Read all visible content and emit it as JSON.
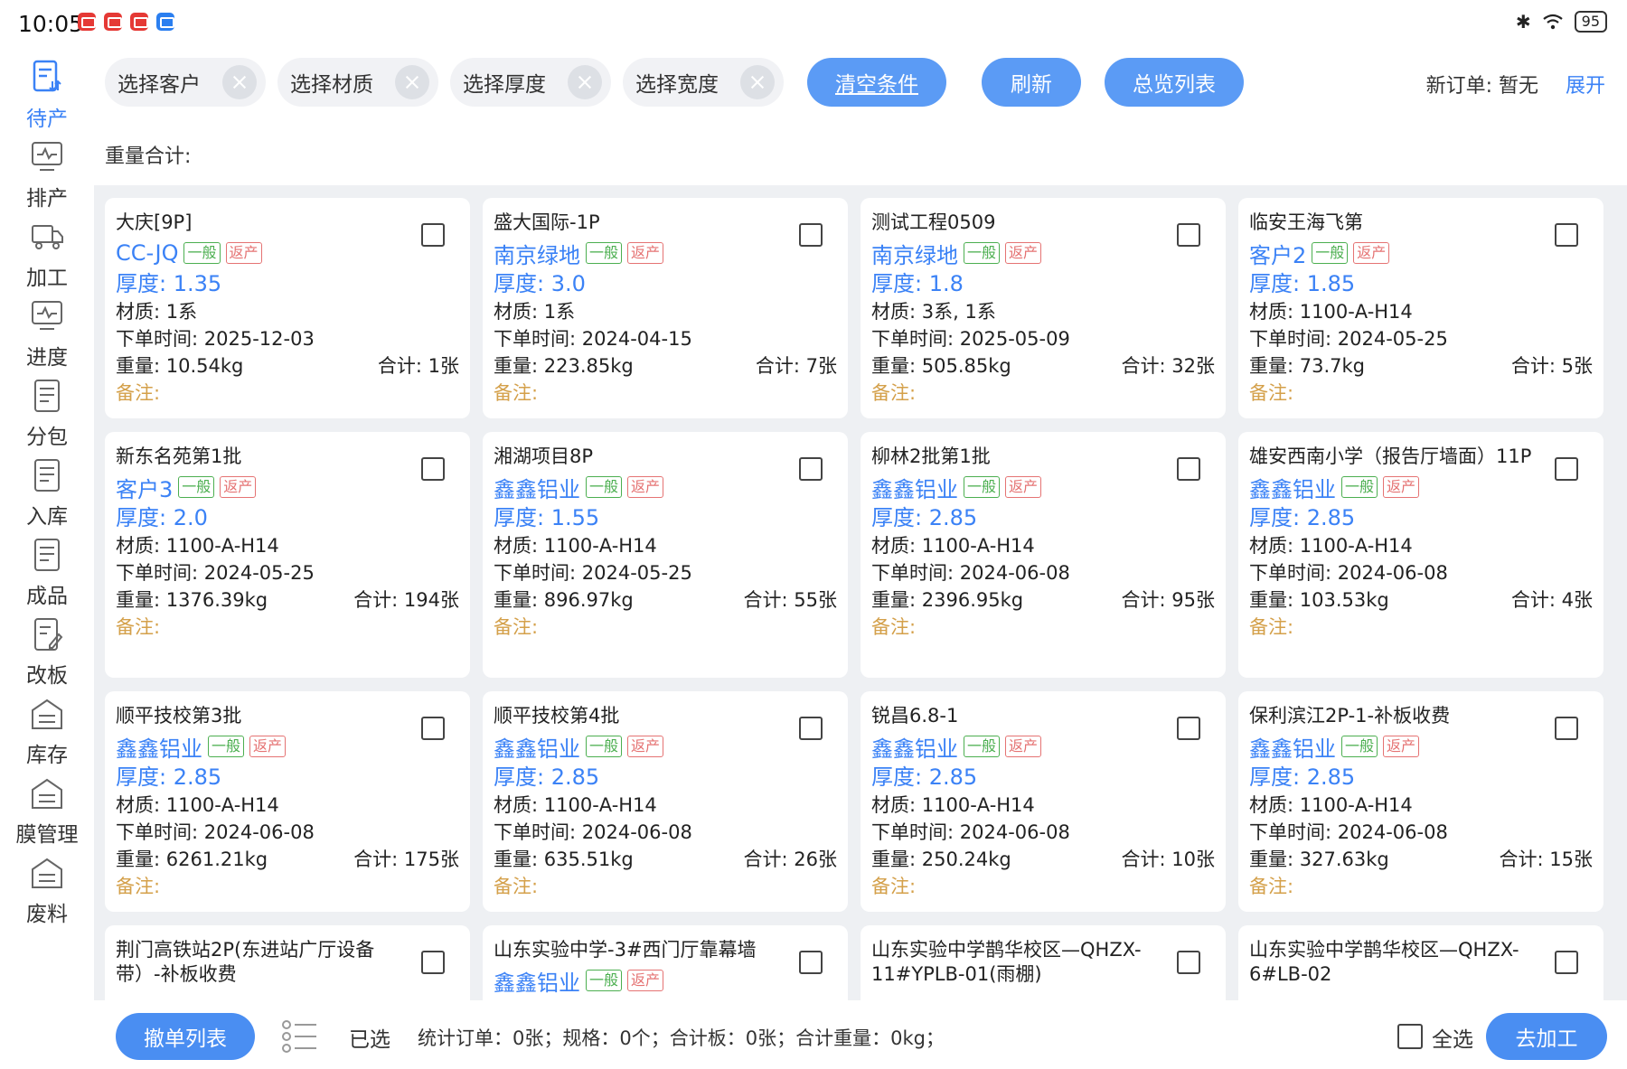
{
  "status_bar": {
    "time": "10:05",
    "battery": "95"
  },
  "sidebar": {
    "items": [
      {
        "label": "待产"
      },
      {
        "label": "排产"
      },
      {
        "label": "加工"
      },
      {
        "label": "进度"
      },
      {
        "label": "分包"
      },
      {
        "label": "入库"
      },
      {
        "label": "成品"
      },
      {
        "label": "改板"
      },
      {
        "label": "库存"
      },
      {
        "label": "膜管理"
      },
      {
        "label": "废料"
      }
    ],
    "active": "待产"
  },
  "filters": {
    "customer": "选择客户",
    "material": "选择材质",
    "thickness": "选择厚度",
    "width": "选择宽度"
  },
  "buttons": {
    "clear": "清空条件",
    "refresh": "刷新",
    "overview": "总览列表",
    "cancel_list": "撤单列表",
    "process": "去加工"
  },
  "new_order": {
    "label": "新订单:",
    "value": "暂无"
  },
  "expand": "展开",
  "weight_total_label": "重量合计:",
  "labels": {
    "tag_normal": "一般",
    "tag_return": "返产",
    "thickness": "厚度:",
    "material": "材质:",
    "order_time": "下单时间:",
    "weight": "重量:",
    "total": "合计:",
    "remark": "备注:"
  },
  "cards": [
    {
      "title": "大庆[9P]",
      "customer": "CC-JQ",
      "thickness": "1.35",
      "material": "1系",
      "order_time": "2025-12-03",
      "weight": "10.54kg",
      "total": "1张"
    },
    {
      "title": "盛大国际-1P",
      "customer": "南京绿地",
      "thickness": "3.0",
      "material": "1系",
      "order_time": "2024-04-15",
      "weight": "223.85kg",
      "total": "7张"
    },
    {
      "title": "测试工程0509",
      "customer": "南京绿地",
      "thickness": "1.8",
      "material": "3系, 1系",
      "order_time": "2025-05-09",
      "weight": "505.85kg",
      "total": "32张"
    },
    {
      "title": "临安王海飞第",
      "customer": "客户2",
      "thickness": "1.85",
      "material": "1100-A-H14",
      "order_time": "2024-05-25",
      "weight": "73.7kg",
      "total": "5张"
    },
    {
      "title": "新东名苑第1批",
      "customer": "客户3",
      "thickness": "2.0",
      "material": "1100-A-H14",
      "order_time": "2024-05-25",
      "weight": "1376.39kg",
      "total": "194张"
    },
    {
      "title": "湘湖项目8P",
      "customer": "鑫鑫铝业",
      "thickness": "1.55",
      "material": "1100-A-H14",
      "order_time": "2024-05-25",
      "weight": "896.97kg",
      "total": "55张"
    },
    {
      "title": "柳林2批第1批",
      "customer": "鑫鑫铝业",
      "thickness": "2.85",
      "material": "1100-A-H14",
      "order_time": "2024-06-08",
      "weight": "2396.95kg",
      "total": "95张"
    },
    {
      "title": "雄安西南小学（报告厅墙面）11P",
      "customer": "鑫鑫铝业",
      "thickness": "2.85",
      "material": "1100-A-H14",
      "order_time": "2024-06-08",
      "weight": "103.53kg",
      "total": "4张"
    },
    {
      "title": "顺平技校第3批",
      "customer": "鑫鑫铝业",
      "thickness": "2.85",
      "material": "1100-A-H14",
      "order_time": "2024-06-08",
      "weight": "6261.21kg",
      "total": "175张"
    },
    {
      "title": "顺平技校第4批",
      "customer": "鑫鑫铝业",
      "thickness": "2.85",
      "material": "1100-A-H14",
      "order_time": "2024-06-08",
      "weight": "635.51kg",
      "total": "26张"
    },
    {
      "title": "锐昌6.8-1",
      "customer": "鑫鑫铝业",
      "thickness": "2.85",
      "material": "1100-A-H14",
      "order_time": "2024-06-08",
      "weight": "250.24kg",
      "total": "10张"
    },
    {
      "title": "保利滨江2P-1-补板收费",
      "customer": "鑫鑫铝业",
      "thickness": "2.85",
      "material": "1100-A-H14",
      "order_time": "2024-06-08",
      "weight": "327.63kg",
      "total": "15张"
    },
    {
      "title": "荆门高铁站2P(东进站广厅设备带）-补板收费"
    },
    {
      "title": "山东实验中学-3#西门厅靠幕墙",
      "customer": "鑫鑫铝业"
    },
    {
      "title": "山东实验中学鹊华校区—QHZX-11#YPLB-01(雨棚)"
    },
    {
      "title": "山东实验中学鹊华校区—QHZX-6#LB-02"
    }
  ],
  "bottom": {
    "selected": "已选",
    "stats": "统计订单：0张；规格：0个；合计板：0张；合计重量：0kg；",
    "select_all": "全选"
  }
}
